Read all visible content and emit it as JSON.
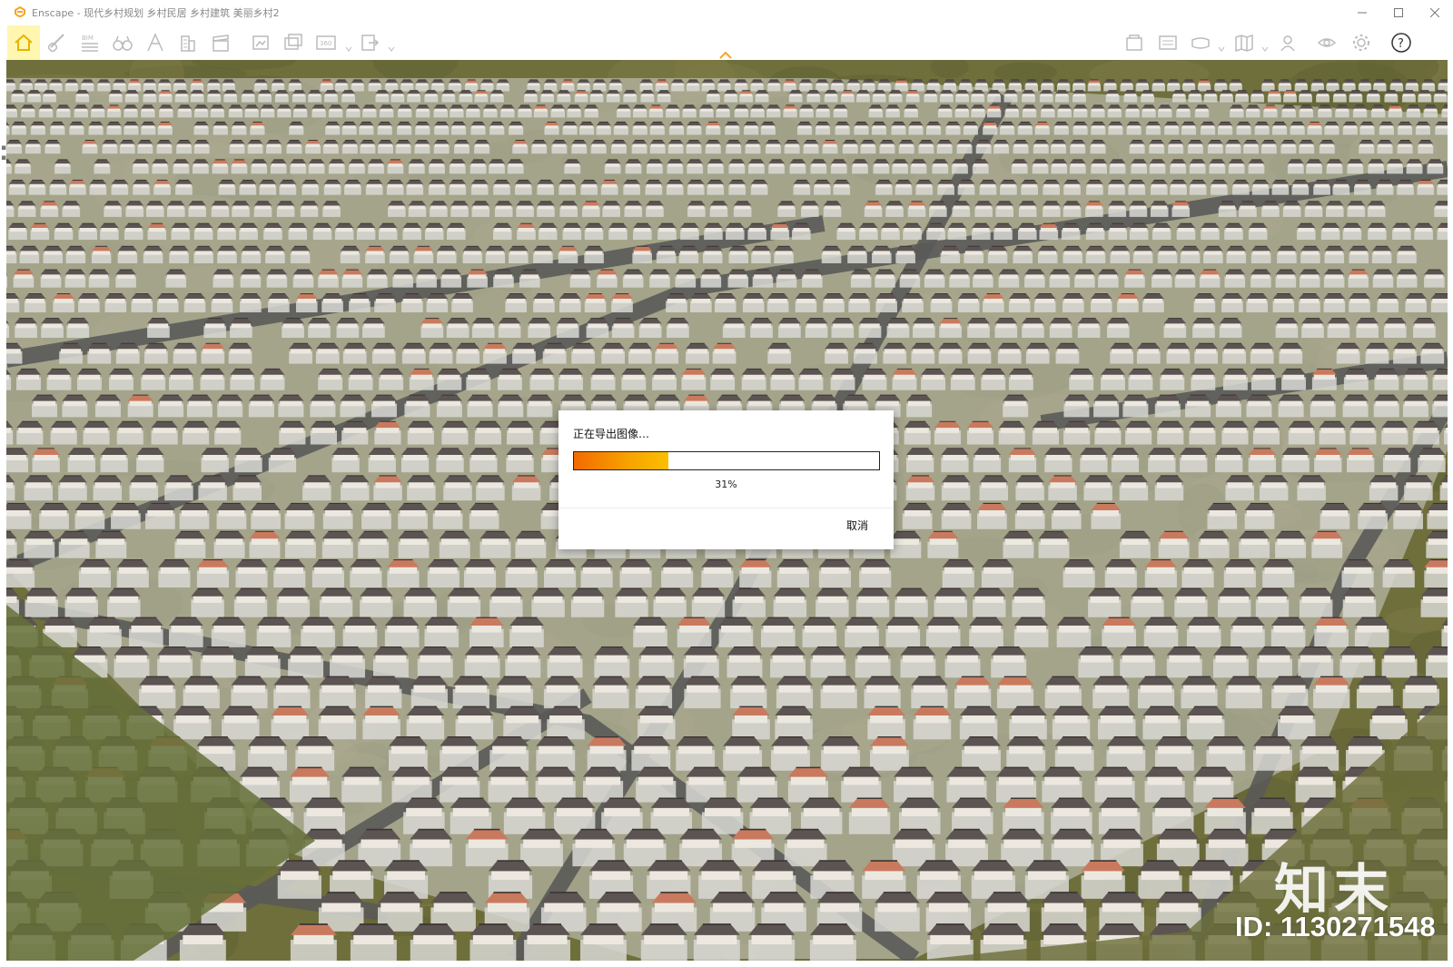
{
  "window": {
    "title": "Enscape - 现代乡村规划 乡村民居 乡村建筑 美丽乡村2",
    "controls": [
      "minimize",
      "maximize",
      "close"
    ],
    "accent_color": "#f5a623"
  },
  "toolbar": {
    "left_tools": [
      {
        "icon": "home-icon",
        "active": true
      },
      {
        "icon": "link-icon"
      },
      {
        "icon": "bim-icon",
        "label": "BIM"
      },
      {
        "icon": "binoculars-icon"
      },
      {
        "icon": "compass-icon"
      },
      {
        "icon": "building-icon"
      },
      {
        "icon": "clapper-icon"
      },
      {
        "icon": "screenshot-icon"
      },
      {
        "icon": "batch-render-icon"
      },
      {
        "icon": "panorama-360-icon",
        "label": "360",
        "dropdown": true
      },
      {
        "icon": "export-icon",
        "dropdown": true
      }
    ],
    "right_tools": [
      {
        "icon": "asset-library-icon"
      },
      {
        "icon": "visual-settings-icon"
      },
      {
        "icon": "vr-headset-icon",
        "dropdown": true
      },
      {
        "icon": "map-icon",
        "dropdown": true
      },
      {
        "icon": "collaboration-icon"
      },
      {
        "icon": "eye-icon"
      },
      {
        "icon": "settings-gear-icon"
      },
      {
        "icon": "help-icon",
        "label": "?"
      }
    ]
  },
  "dialog": {
    "title": "正在导出图像…",
    "progress_percent": 31,
    "progress_text": "31%",
    "cancel_label": "取消"
  },
  "watermark": {
    "logo_text": "知末",
    "id_text": "ID: 1130271548"
  },
  "viewport": {
    "scene": "aerial view of rural village rendering",
    "colors": {
      "grass": "#6f6f3c",
      "road": "#5a5a58",
      "roof": "#5c5452",
      "roof_alt": "#c97a5e",
      "yard": "#d8d8d4"
    }
  }
}
